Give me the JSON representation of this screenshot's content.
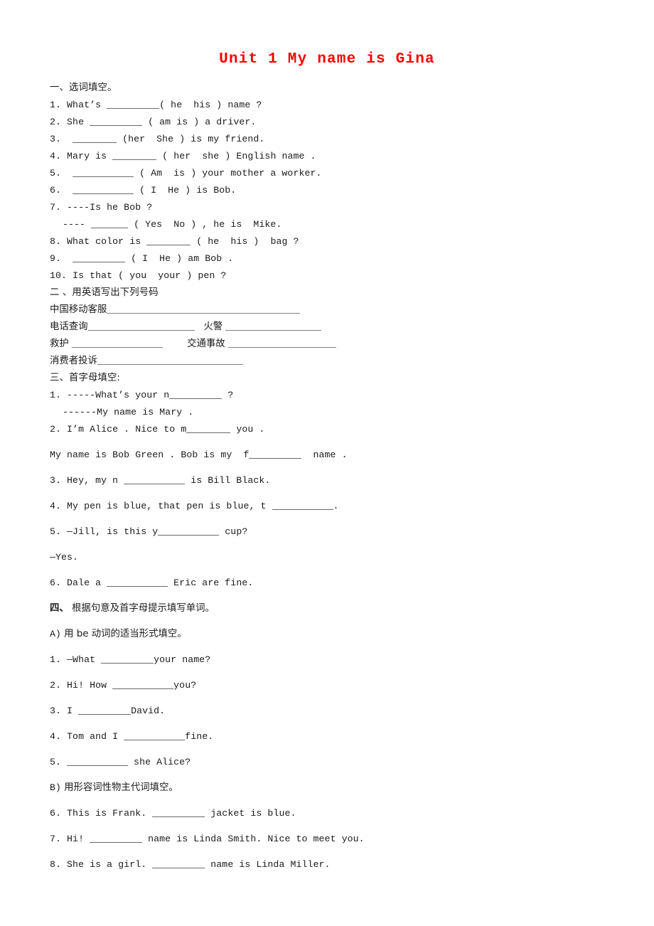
{
  "document": {
    "title": "Unit 1 My name is Gina",
    "title_color": "#fd0000",
    "page_background": "#ffffff",
    "text_color": "#1a1a1a"
  },
  "section_one": {
    "heading": "一、选词填空。",
    "items": [
      {
        "num": "1.",
        "pre": "What’s ",
        "post": "( he  his ) name ?"
      },
      {
        "num": "2.",
        "pre": "She ",
        "post": " ( am is ) a driver."
      },
      {
        "num": "3.",
        "pre": "",
        "post": " (her  She ) is my friend."
      },
      {
        "num": "4.",
        "pre": "Mary is ",
        "post": " ( her  she ) English name ."
      },
      {
        "num": "5.",
        "pre": "",
        "post": " ( Am  is ) your mother a worker."
      },
      {
        "num": "6.",
        "pre": "",
        "post": " ( I  He ) is Bob."
      },
      {
        "num": "7.",
        "pre": "----Is he Bob ?",
        "post": ""
      },
      {
        "num": "",
        "pre": "---- ",
        "post": " ( Yes  No ) , he is  Mike."
      },
      {
        "num": "8.",
        "pre": "What color is ",
        "post": " ( he  his )  bag ?"
      },
      {
        "num": "9.",
        "pre": "",
        "post": " ( I  He ) am Bob ."
      },
      {
        "num": "10.",
        "pre": "Is that ( you  your ) pen ?",
        "post": ""
      }
    ]
  },
  "section_two": {
    "heading": "二 、用英语写出下列号码",
    "rows": [
      {
        "label_a": "中国移动客服",
        "label_b": ""
      },
      {
        "label_a": "电话查询",
        "label_b": "火警 "
      },
      {
        "label_a": "救护 ",
        "label_b": "交通事故 "
      },
      {
        "label_a": "消费者投诉",
        "label_b": ""
      }
    ]
  },
  "section_three": {
    "heading": "三、首字母填空:",
    "items": [
      {
        "num": "1.",
        "pre": "-----What’s your n",
        "post": " ?"
      },
      {
        "num": "",
        "pre": "------My name is Mary .",
        "post": ""
      },
      {
        "num": "2.",
        "pre": "I’m Alice . Nice to m",
        "post": " you ."
      },
      {
        "num": "",
        "pre": "My name is Bob Green . Bob is my  f",
        "post": "  name ."
      },
      {
        "num": "3.",
        "pre": "Hey, my n ",
        "post": " is Bill Black."
      },
      {
        "num": "4.",
        "pre": "My pen is blue, that pen is blue, t ",
        "post": "."
      },
      {
        "num": "5.",
        "pre": "—Jill, is this y",
        "post": " cup?"
      },
      {
        "num": "",
        "pre": "—Yes.",
        "post": ""
      },
      {
        "num": "6.",
        "pre": "Dale a ",
        "post": " Eric are fine."
      }
    ]
  },
  "section_four": {
    "heading_num": "四、",
    "heading_text": " 根据句意及首字母提示填写单词。",
    "part_a": {
      "label": "A)",
      "title": " 用 be 动词的适当形式填空。",
      "items": [
        {
          "num": "1.",
          "pre": "—What ",
          "post": "your name?"
        },
        {
          "num": "2.",
          "pre": "Hi! How ",
          "post": "you?"
        },
        {
          "num": "3.",
          "pre": "I ",
          "post": "David."
        },
        {
          "num": "4.",
          "pre": "Tom and I ",
          "post": "fine."
        },
        {
          "num": "5.",
          "pre": "",
          "post": " she Alice?"
        }
      ]
    },
    "part_b": {
      "label": "B)",
      "title": " 用形容词性物主代词填空。",
      "items": [
        {
          "num": "6.",
          "pre": "This is Frank. ",
          "post": " jacket is blue."
        },
        {
          "num": "7.",
          "pre": "Hi! ",
          "post": " name is Linda Smith. Nice to meet you."
        },
        {
          "num": "8.",
          "pre": "She is a girl. ",
          "post": " name is Linda Miller."
        }
      ]
    }
  }
}
